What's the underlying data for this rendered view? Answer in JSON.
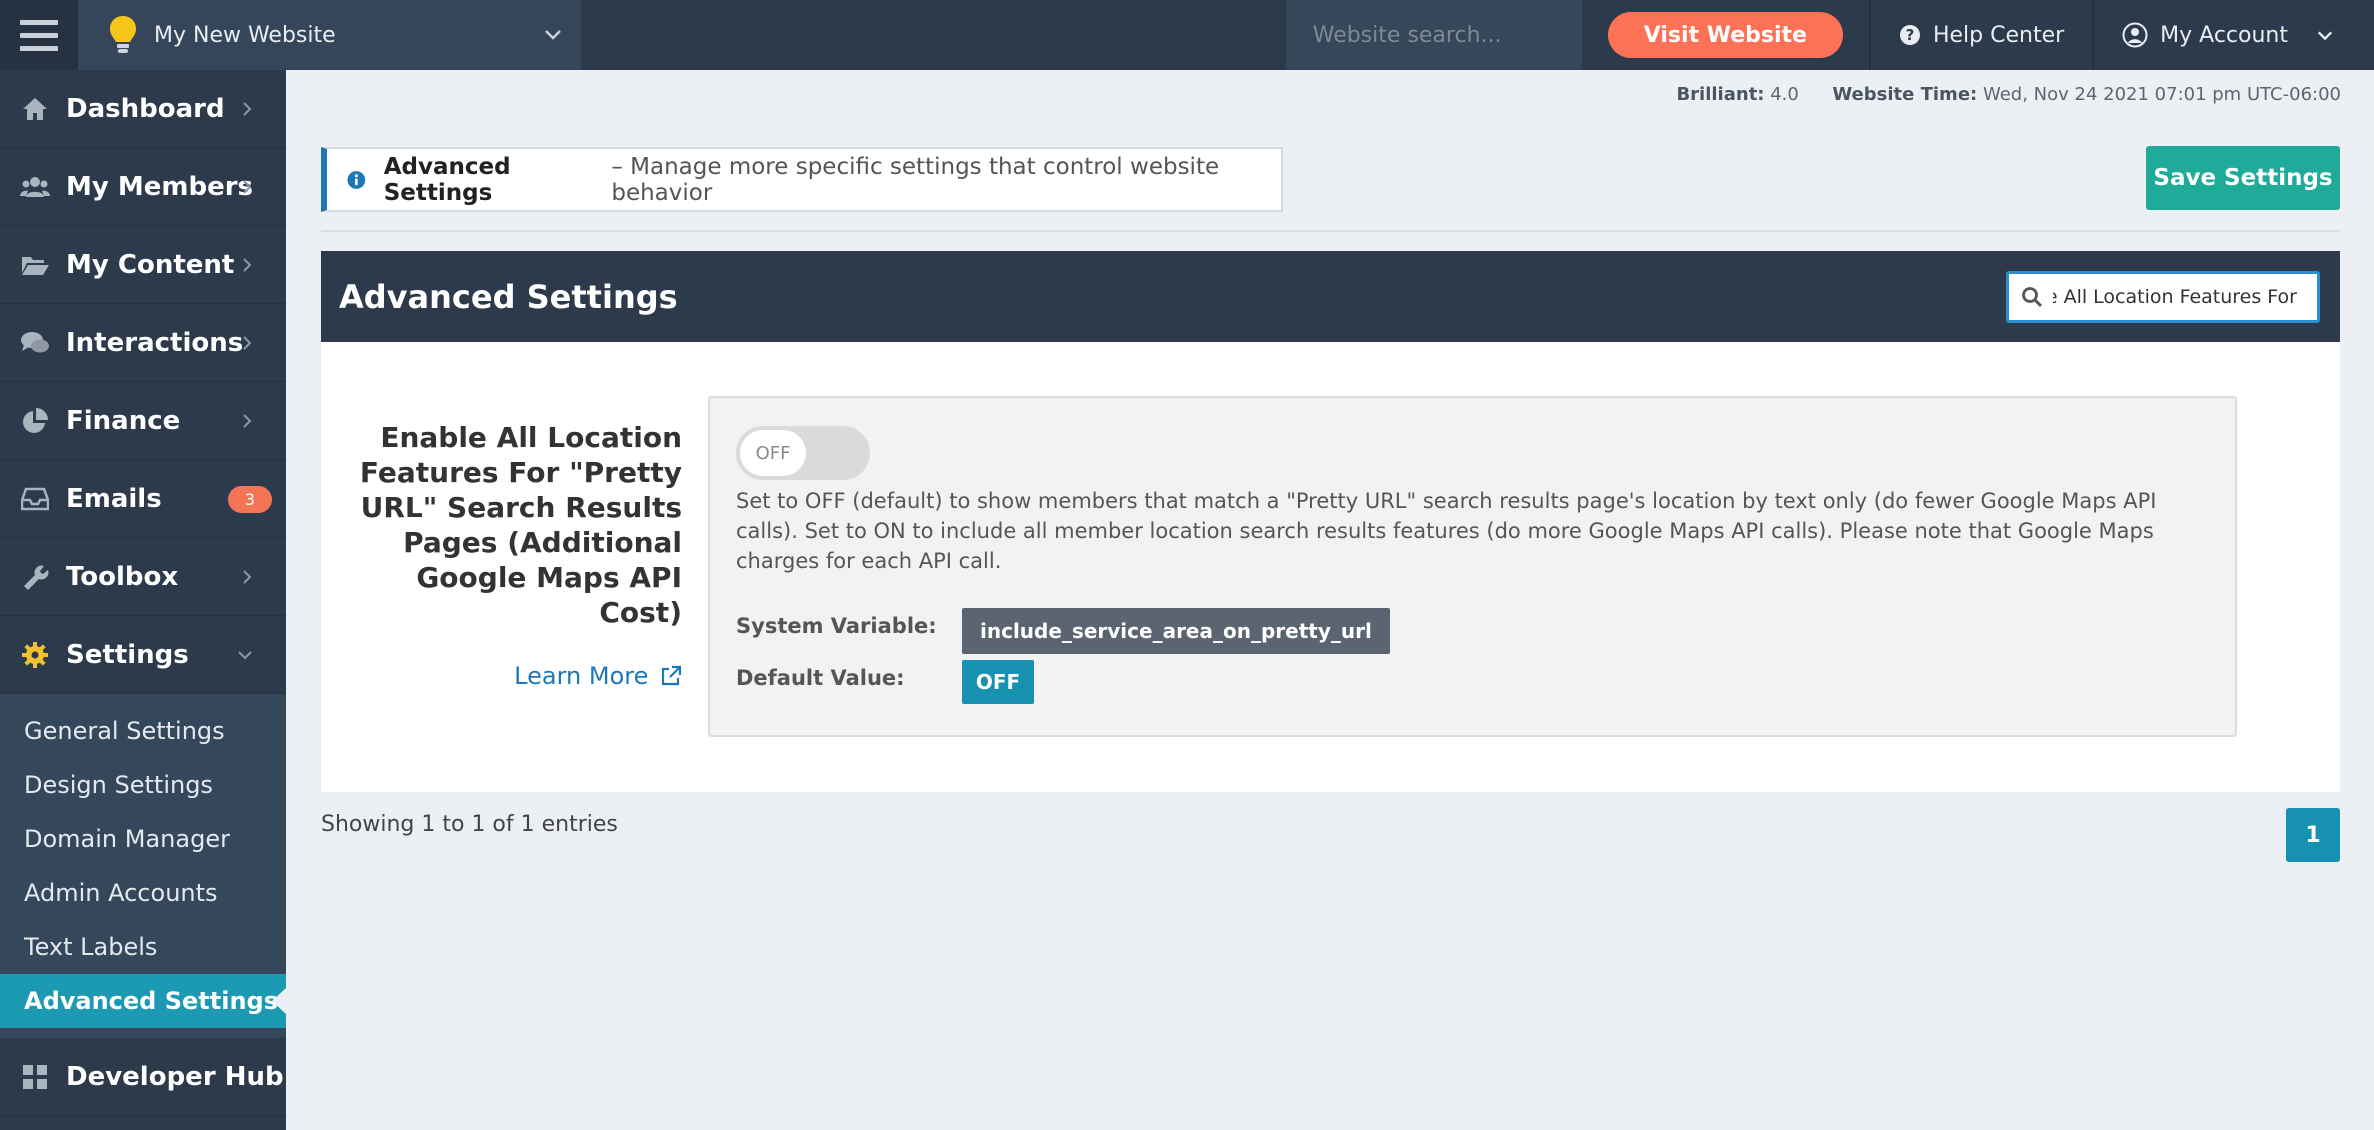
{
  "topbar": {
    "site_name": "My New Website",
    "search_placeholder": "Website search...",
    "visit_label": "Visit Website",
    "help_label": "Help Center",
    "account_label": "My Account"
  },
  "sidebar": {
    "items": [
      {
        "label": "Dashboard"
      },
      {
        "label": "My Members"
      },
      {
        "label": "My Content"
      },
      {
        "label": "Interactions"
      },
      {
        "label": "Finance"
      },
      {
        "label": "Emails",
        "badge": "3"
      },
      {
        "label": "Toolbox"
      },
      {
        "label": "Settings"
      }
    ],
    "sub_items": [
      {
        "label": "General Settings"
      },
      {
        "label": "Design Settings"
      },
      {
        "label": "Domain Manager"
      },
      {
        "label": "Admin Accounts"
      },
      {
        "label": "Text Labels"
      },
      {
        "label": "Advanced Settings"
      }
    ],
    "developer_label": "Developer Hub"
  },
  "meta": {
    "brilliant_label": "Brilliant:",
    "brilliant_value": "4.0",
    "time_label": "Website Time:",
    "time_value": "Wed, Nov 24 2021 07:01 pm UTC-06:00"
  },
  "info": {
    "title": "Advanced Settings",
    "description": " – Manage more specific settings that control website behavior"
  },
  "save_label": "Save Settings",
  "panel": {
    "title": "Advanced Settings",
    "search_value": "Enable All Location Features For"
  },
  "setting": {
    "label": "Enable All Location Features For \"Pretty URL\" Search Results Pages (Additional Google Maps API Cost)",
    "learn_more": "Learn More",
    "toggle_state": "OFF",
    "description": "Set to OFF (default) to show members that match a \"Pretty URL\" search results page's location by text only (do fewer Google Maps API calls). Set to ON to include all member location search results features (do more Google Maps API calls). Please note that Google Maps charges for each API call.",
    "system_variable_label": "System Variable:",
    "system_variable_value": "include_service_area_on_pretty_url",
    "default_value_label": "Default Value:",
    "default_value": "OFF"
  },
  "footer": {
    "showing": "Showing 1 to 1 of 1 entries",
    "page": "1"
  },
  "colors": {
    "accent": "#1692b0",
    "visit": "#fd7257",
    "save": "#1eab99",
    "nav_bg": "#2c3a4b"
  },
  "icons": {
    "menu": "hamburger-icon",
    "logo": "lightbulb-icon",
    "help": "question-circle-icon",
    "account": "user-circle-icon",
    "search": "search-icon",
    "info": "info-circle-icon",
    "external": "external-link-icon"
  }
}
